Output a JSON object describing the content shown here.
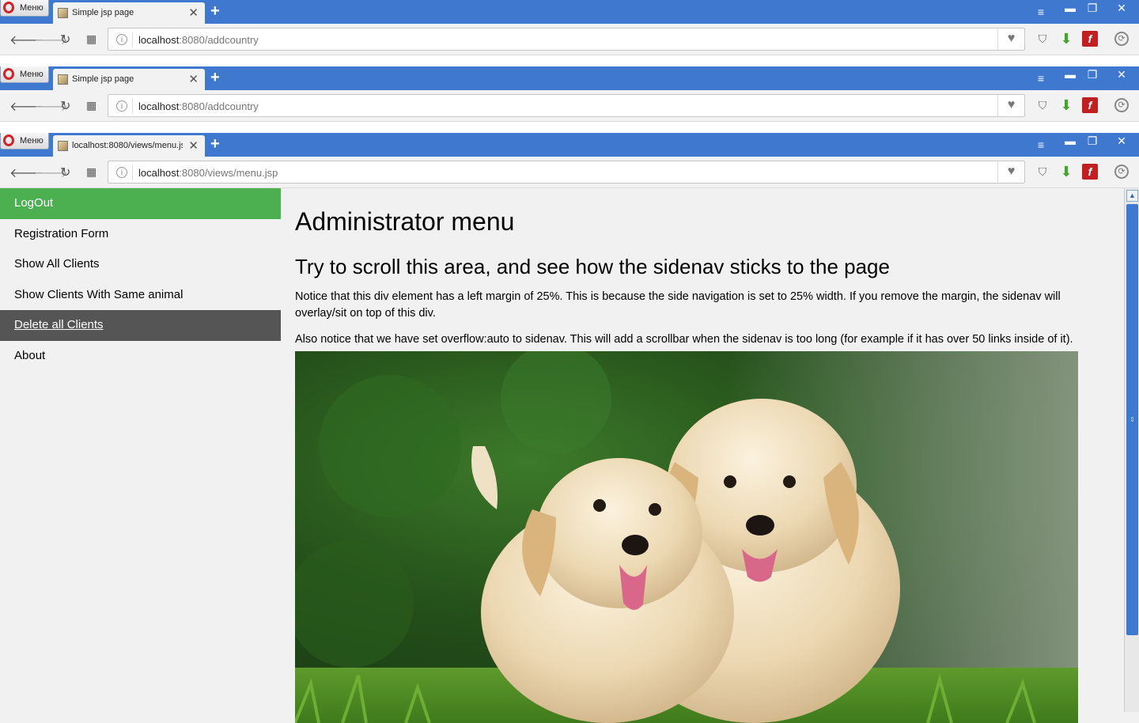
{
  "browser": {
    "menu_label": "Меню",
    "windows": [
      {
        "tab_title": "Simple jsp page",
        "url_host": "localhost",
        "url_rest": ":8080/addcountry"
      },
      {
        "tab_title": "Simple jsp page",
        "url_host": "localhost",
        "url_rest": ":8080/addcountry"
      },
      {
        "tab_title": "localhost:8080/views/menu.js",
        "url_host": "localhost",
        "url_rest": ":8080/views/menu.jsp"
      }
    ],
    "icons": {
      "new_tab": "+",
      "close_tab": "✕",
      "tab_menu": "≡",
      "minimize": "▬",
      "maximize": "❐",
      "close": "✕",
      "back": "🡐",
      "forward": "🡒",
      "reload": "↻",
      "speed_dial": "▦",
      "bookmark": "♥",
      "ublock": "⛉",
      "download": "⬇",
      "flash": "f",
      "update": "⟳"
    }
  },
  "sidenav": {
    "items": [
      {
        "label": "LogOut",
        "state": "active"
      },
      {
        "label": "Registration Form",
        "state": "normal"
      },
      {
        "label": "Show All Clients",
        "state": "normal"
      },
      {
        "label": "Show Clients With Same animal",
        "state": "normal"
      },
      {
        "label": "Delete all Clients",
        "state": "hover"
      },
      {
        "label": "About",
        "state": "normal"
      }
    ],
    "active_color": "#4caf50",
    "hover_color": "#555555"
  },
  "content": {
    "title": "Administrator menu",
    "subtitle": "Try to scroll this area, and see how the sidenav sticks to the page",
    "paragraph1": "Notice that this div element has a left margin of 25%. This is because the side navigation is set to 25% width. If you remove the margin, the sidenav will overlay/sit on top of this div.",
    "paragraph2": "Also notice that we have set overflow:auto to sidenav. This will add a scrollbar when the sidenav is too long (for example if it has over 50 links inside of it)."
  }
}
